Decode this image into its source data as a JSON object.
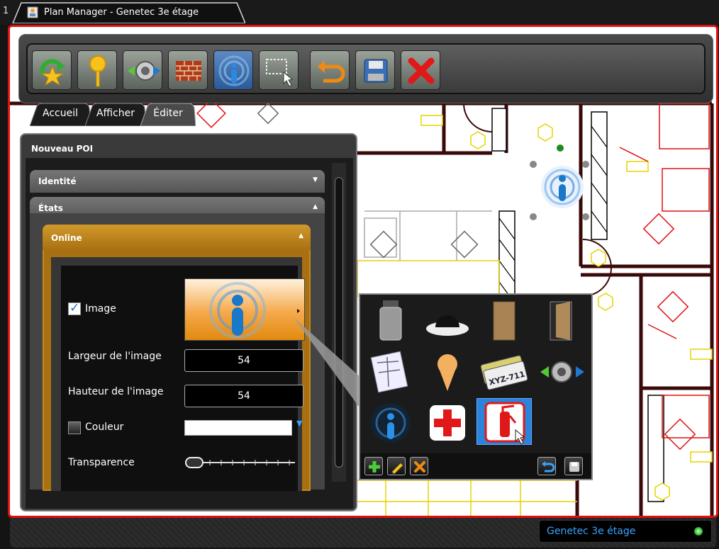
{
  "tabbar": {
    "index": "1",
    "window_title": "Plan Manager - Genetec 3e étage"
  },
  "toolbar": {
    "buttons": [
      {
        "name": "refresh-map-button",
        "icon": "refresh-icon"
      },
      {
        "name": "add-poi-button",
        "icon": "map-pin-icon"
      },
      {
        "name": "add-link-button",
        "icon": "link-arrows-icon"
      },
      {
        "name": "add-wall-button",
        "icon": "brick-wall-icon"
      },
      {
        "name": "poi-button",
        "icon": "poi-signal-icon"
      },
      {
        "name": "select-area-button",
        "icon": "select-area-icon"
      },
      {
        "name": "undo-button",
        "icon": "undo-icon"
      },
      {
        "name": "save-button",
        "icon": "floppy-disk-icon"
      },
      {
        "name": "close-button",
        "icon": "red-x-icon"
      }
    ]
  },
  "nav_tabs": [
    {
      "label": "Accueil",
      "active": false
    },
    {
      "label": "Afficher",
      "active": false
    },
    {
      "label": "Éditer",
      "active": true
    }
  ],
  "panel": {
    "title": "Nouveau POI",
    "sections": {
      "identity": "Identité",
      "states": "États",
      "online": "Online"
    },
    "form": {
      "image_label": "Image",
      "image_checked": true,
      "width_label": "Largeur de l'image",
      "width_value": "54",
      "height_label": "Hauteur de l'image",
      "height_value": "54",
      "color_label": "Couleur",
      "color_checked": false,
      "color_value": "#ffffff",
      "transparency_label": "Transparence",
      "transparency_value": 0
    }
  },
  "icon_picker": {
    "icons": [
      "weight-icon",
      "dome-camera-icon",
      "door-panel-icon",
      "open-door-icon",
      "floor-plan-icon",
      "map-pin-icon",
      "license-plate-icon",
      "link-arrows-icon",
      "poi-signal-icon",
      "first-aid-icon",
      "fire-extinguisher-icon"
    ],
    "selected": "fire-extinguisher-icon",
    "plate_text": "XYZ-711",
    "actions": [
      "add-icon",
      "edit-icon",
      "delete-icon",
      "revert-icon",
      "save-icon"
    ]
  },
  "statusbar": {
    "location": "Genetec 3e étage",
    "status_color": "#2bbf2b"
  },
  "colors": {
    "frame_accent": "#e01010",
    "online_header": "#c48a1e",
    "status_text": "#39a3ff"
  }
}
